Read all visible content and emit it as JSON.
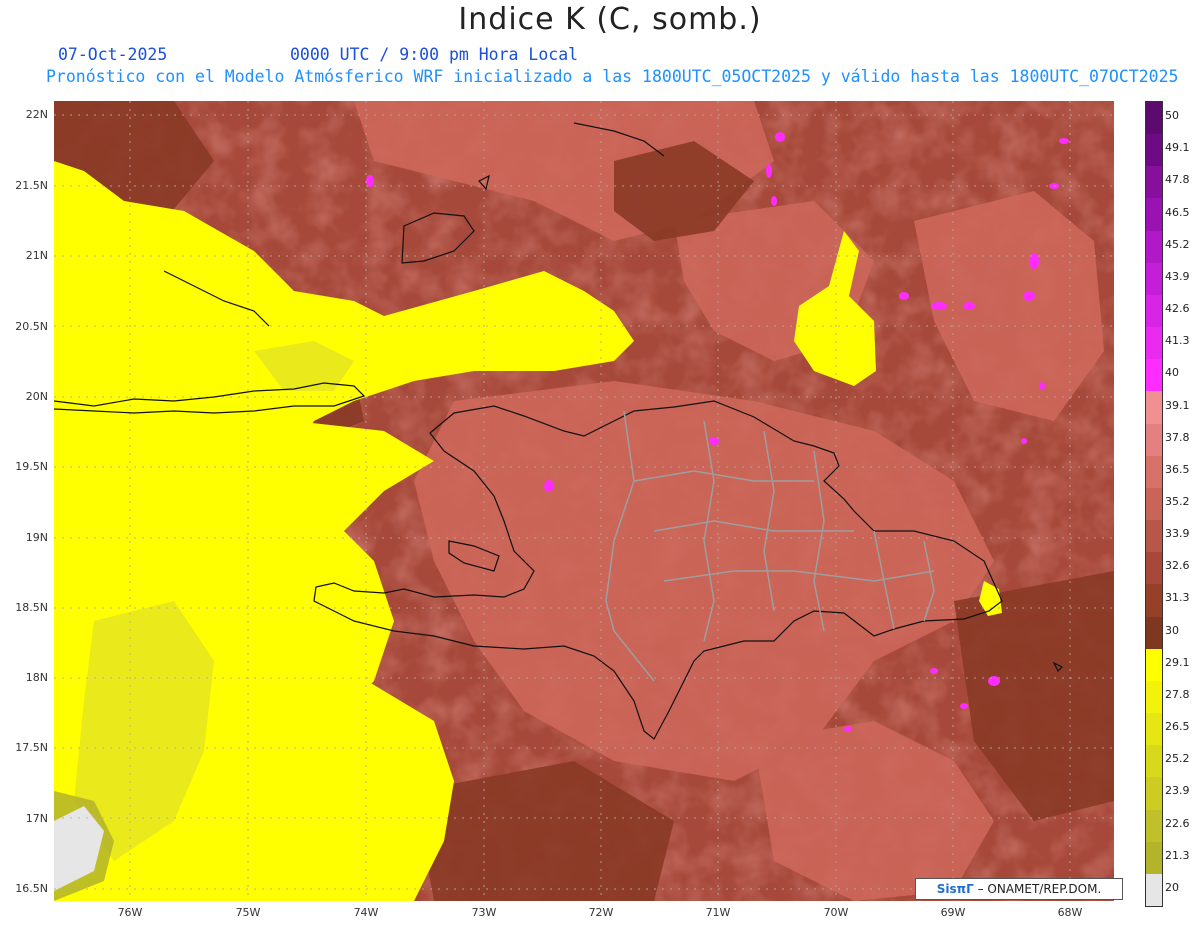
{
  "header": {
    "title": "Indice K (C, somb.)",
    "date": "07-Oct-2025",
    "time": "0000 UTC / 9:00 pm Hora Local",
    "init": "Pronóstico con el Modelo Atmósferico WRF inicializado a las 1800UTC_05OCT2025 y válido hasta las  1800UTC_07OCT2025"
  },
  "map": {
    "lat_labels": [
      "22N",
      "21.5N",
      "21N",
      "20.5N",
      "20N",
      "19.5N",
      "19N",
      "18.5N",
      "18N",
      "17.5N",
      "17N",
      "16.5N"
    ],
    "lon_labels": [
      "76W",
      "75W",
      "74W",
      "73W",
      "72W",
      "71W",
      "70W",
      "69W",
      "68W"
    ]
  },
  "colorbar": {
    "labels": [
      "50",
      "49.1",
      "47.8",
      "46.5",
      "45.2",
      "43.9",
      "42.6",
      "41.3",
      "40",
      "39.1",
      "37.8",
      "36.5",
      "35.2",
      "33.9",
      "32.6",
      "31.3",
      "30",
      "29.1",
      "27.8",
      "26.5",
      "25.2",
      "23.9",
      "22.6",
      "21.3",
      "20"
    ],
    "colors": [
      "#5c0a6e",
      "#6e0a84",
      "#86109c",
      "#9a12b4",
      "#b018c8",
      "#c41ed8",
      "#d824e6",
      "#ea2af0",
      "#ff2cff",
      "#f09090",
      "#e58080",
      "#d87268",
      "#c86458",
      "#b85648",
      "#a84838",
      "#964028",
      "#7e3820",
      "#ffff00",
      "#f2f20a",
      "#e6e614",
      "#d9d91c",
      "#cccc22",
      "#c0c028",
      "#b3b32c",
      "#e6e6e6"
    ]
  },
  "credit": {
    "logo": "SisπΓ",
    "text": "– ONAMET/REP.DOM."
  }
}
